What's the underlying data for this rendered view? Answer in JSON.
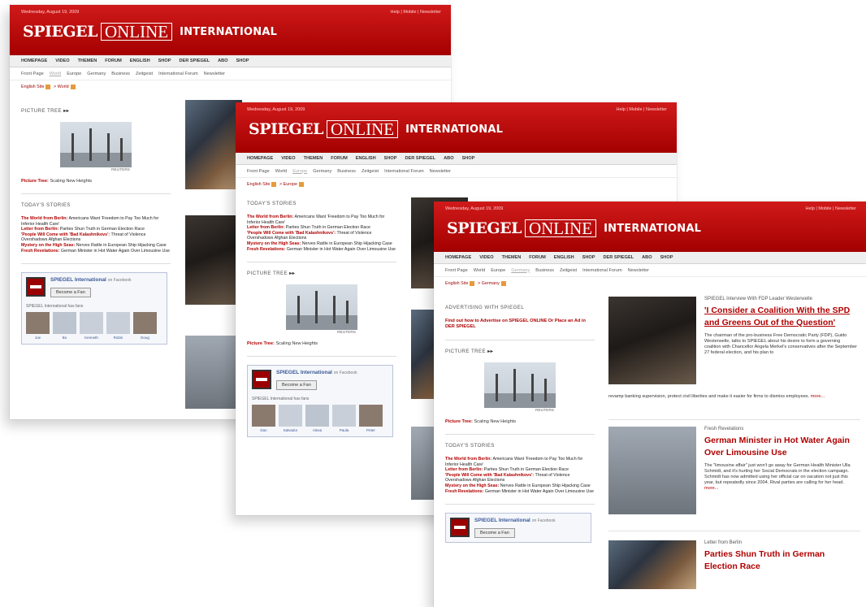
{
  "shared": {
    "date": "Wednesday, August 19, 2009",
    "header_links": "Help | Mobile | Newsletter",
    "logo_spiegel": "SPIEGEL",
    "logo_online": "ONLINE",
    "logo_international": "INTERNATIONAL",
    "nav": [
      "HOMEPAGE",
      "VIDEO",
      "THEMEN",
      "FORUM",
      "ENGLISH",
      "SHOP",
      "DER SPIEGEL",
      "ABO",
      "SHOP"
    ],
    "subnav": [
      "Front Page",
      "World",
      "Europe",
      "Germany",
      "Business",
      "Zeitgeist",
      "International Forum",
      "Newsletter"
    ],
    "crumb_home": "English Site",
    "picture_tree_heading": "PICTURE TREE",
    "picture_tree_arrow": "▸▸",
    "photo_credit": "REUTERS",
    "picture_tree_link_bold": "Picture Tree:",
    "picture_tree_link_text": "Scaling New Heights",
    "todays_stories_heading": "TODAY'S STORIES",
    "stories": [
      {
        "bold": "The World from Berlin:",
        "text": "Americans Want 'Freedom to Pay Too Much for Inferior Health Care'"
      },
      {
        "bold": "Letter from Berlin:",
        "text": "Parties Shun Truth in German Election Race"
      },
      {
        "bold": "'People Will Come with 'Bad Kalashnikovs':",
        "text": "Threat of Violence Overshadows Afghan Elections"
      },
      {
        "bold": "Mystery on the High Seas:",
        "text": "Nerves Rattle in European Ship Hijacking Case"
      },
      {
        "bold": "Fresh Revelations:",
        "text": "German Minister in Hot Water Again Over Limousine Use"
      }
    ],
    "fb_name": "SPIEGEL International",
    "fb_on": "on Facebook",
    "fb_button": "Become a Fan",
    "fb_sub": "SPIEGEL International has fans",
    "fb_fans_1": [
      "Joe",
      "Bo",
      "Kenneth",
      "Robin",
      "Doug"
    ],
    "fb_fans_2": [
      "Dan",
      "Salvador",
      "Alexa",
      "Paula",
      "Peter"
    ]
  },
  "window_1": {
    "crumb_section": "World"
  },
  "window_2": {
    "crumb_section": "Europe"
  },
  "window_3": {
    "crumb_section": "Germany",
    "advertising_heading": "ADVERTISING WITH SPIEGEL",
    "advertising_link": "Find out how to Advertise on SPIEGEL ONLINE Or Place an Ad in DER SPIEGEL",
    "articles": [
      {
        "kicker": "SPIEGEL Interview With FDP Leader Westerwelle",
        "headline": "'I Consider a Coalition With the SPD and Greens Out of the Question'",
        "teaser": "The chairman of the pro-business Free Democratic Party (FDP), Guido Westerwelle, talks to SPIEGEL about his desire to form a governing coalition with Chancellor Angela Merkel's conservatives after the September 27 federal election, and his plan to",
        "teaser_wide": "revamp banking supervision, protect civil liberties and make it easier for firms to dismiss employees.",
        "more": "more..."
      },
      {
        "kicker": "Fresh Revelations",
        "headline": "German Minister in Hot Water Again Over Limousine Use",
        "teaser": "The \"limousine affair\" just won't go away for German Health Minister Ulla Schmidt, and it's hurting her Social Democrats in the election campaign. Schmidt has now admitted using her official car on vacation not just this year, but repeatedly since 2004. Rival parties are calling for her head.",
        "more": "more..."
      },
      {
        "kicker": "Letter from Berlin",
        "headline": "Parties Shun Truth in German Election Race"
      }
    ]
  }
}
